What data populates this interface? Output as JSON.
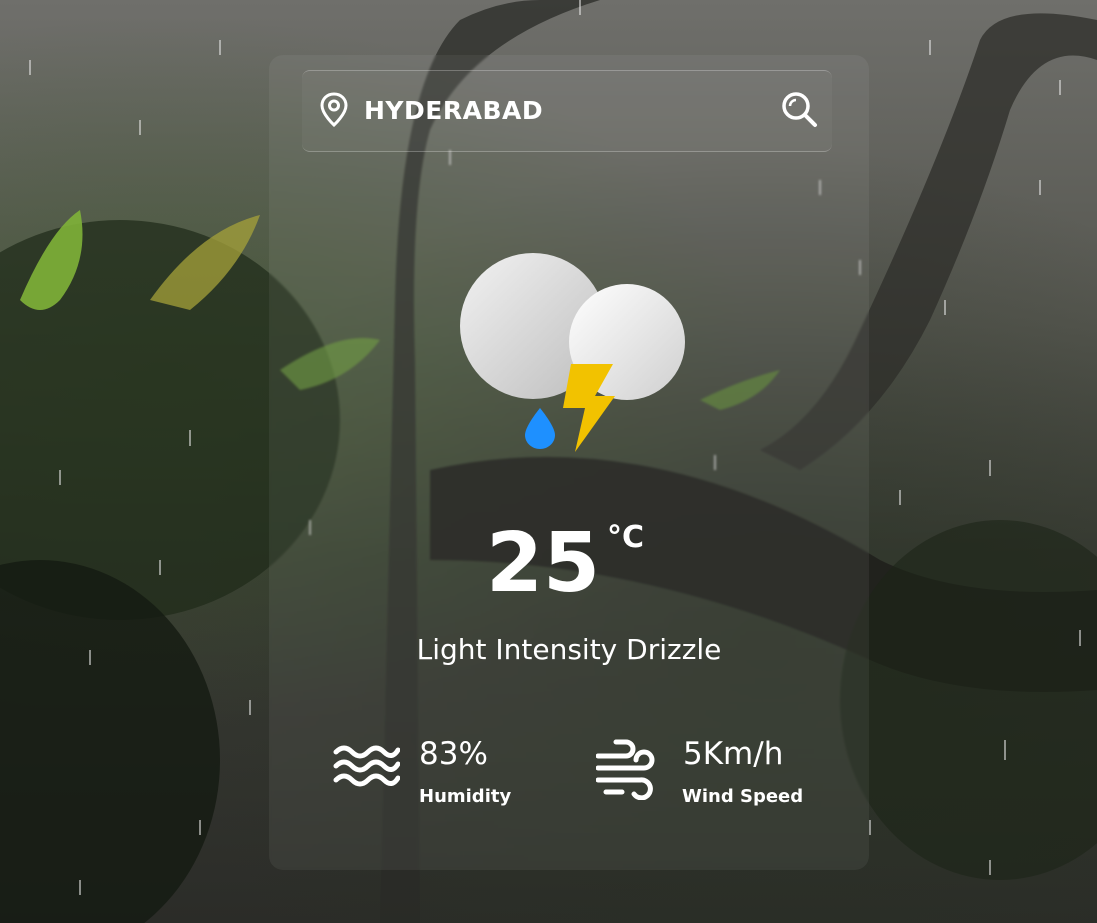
{
  "search": {
    "city_value": "HYDERABAD",
    "placeholder": ""
  },
  "icons": {
    "location": "location-pin-icon",
    "search": "search-icon",
    "weather": "cloud-thunder-drizzle-icon",
    "humidity": "waves-icon",
    "wind": "wind-icon"
  },
  "weather": {
    "temperature": "25",
    "unit": "°C",
    "description": "Light Intensity Drizzle"
  },
  "stats": {
    "humidity": {
      "value": "83%",
      "label": "Humidity"
    },
    "wind": {
      "value": "5Km/h",
      "label": "Wind Speed"
    }
  },
  "colors": {
    "text": "#ffffff",
    "bolt": "#f2c200",
    "drop": "#1e90ff",
    "cloud": "#e9e9e9"
  }
}
